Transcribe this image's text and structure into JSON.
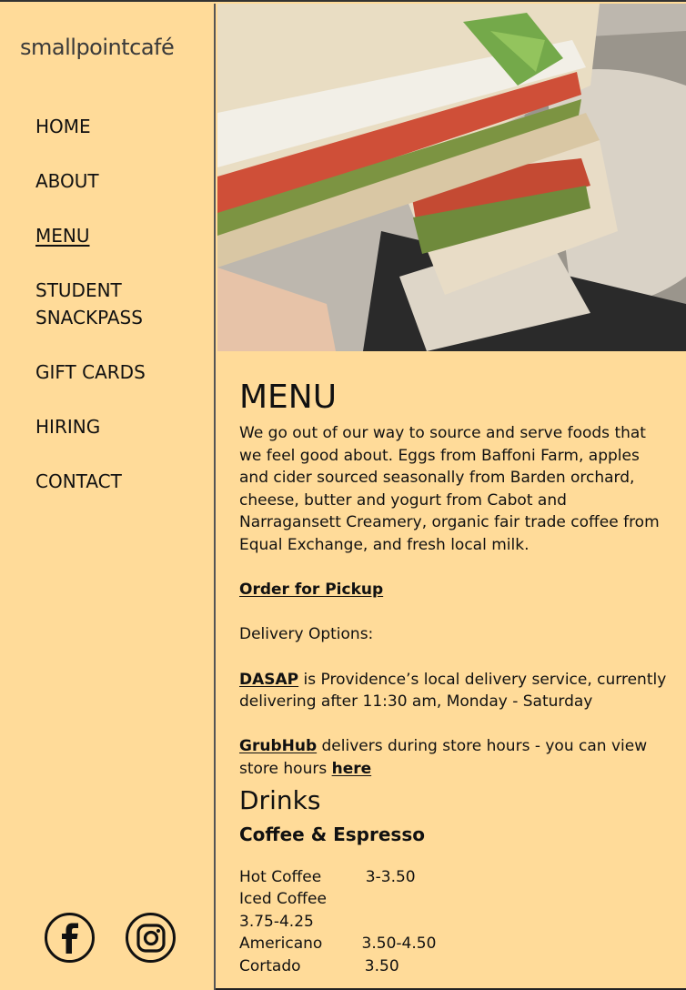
{
  "logo": {
    "part1": "small",
    "part2": "point",
    "part3": "café"
  },
  "nav": {
    "items": [
      {
        "label": "HOME"
      },
      {
        "label": "ABOUT"
      },
      {
        "label": "MENU"
      },
      {
        "label": "STUDENT SNACKPASS"
      },
      {
        "label": "GIFT CARDS"
      },
      {
        "label": "HIRING"
      },
      {
        "label": "CONTACT"
      }
    ]
  },
  "social": {
    "facebook": "facebook-icon",
    "instagram": "instagram-icon"
  },
  "colors": {
    "background": "#ffdb99",
    "text": "#111111",
    "logo_dot": "#e0522a"
  },
  "content": {
    "title": "MENU",
    "intro": "We go out of our way to source and serve foods that we feel good about. Eggs from Baffoni Farm, apples and cider sourced seasonally from Barden orchard, cheese, butter and yogurt from Cabot and Narragansett Creamery, organic fair trade coffee from Equal Exchange, and fresh local milk.",
    "order_link": "Order for Pickup",
    "delivery_label": "Delivery Options:",
    "dasap_link": "DASAP",
    "dasap_text": " is Providence’s local delivery service, currently delivering after 11:30 am, Monday - Saturday",
    "grubhub_link": "GrubHub",
    "grubhub_text": " delivers during store hours - you can view store hours ",
    "here_link": "here",
    "drinks_heading": "Drinks",
    "coffee_heading": "Coffee & Espresso",
    "items": [
      {
        "name": "Hot Coffee",
        "price": "3-3.50"
      },
      {
        "name": "Iced Coffee",
        "price": "3.75-4.25"
      },
      {
        "name": "Americano",
        "price": "3.50-4.50"
      },
      {
        "name": "Cortado",
        "price": "3.50"
      }
    ]
  }
}
